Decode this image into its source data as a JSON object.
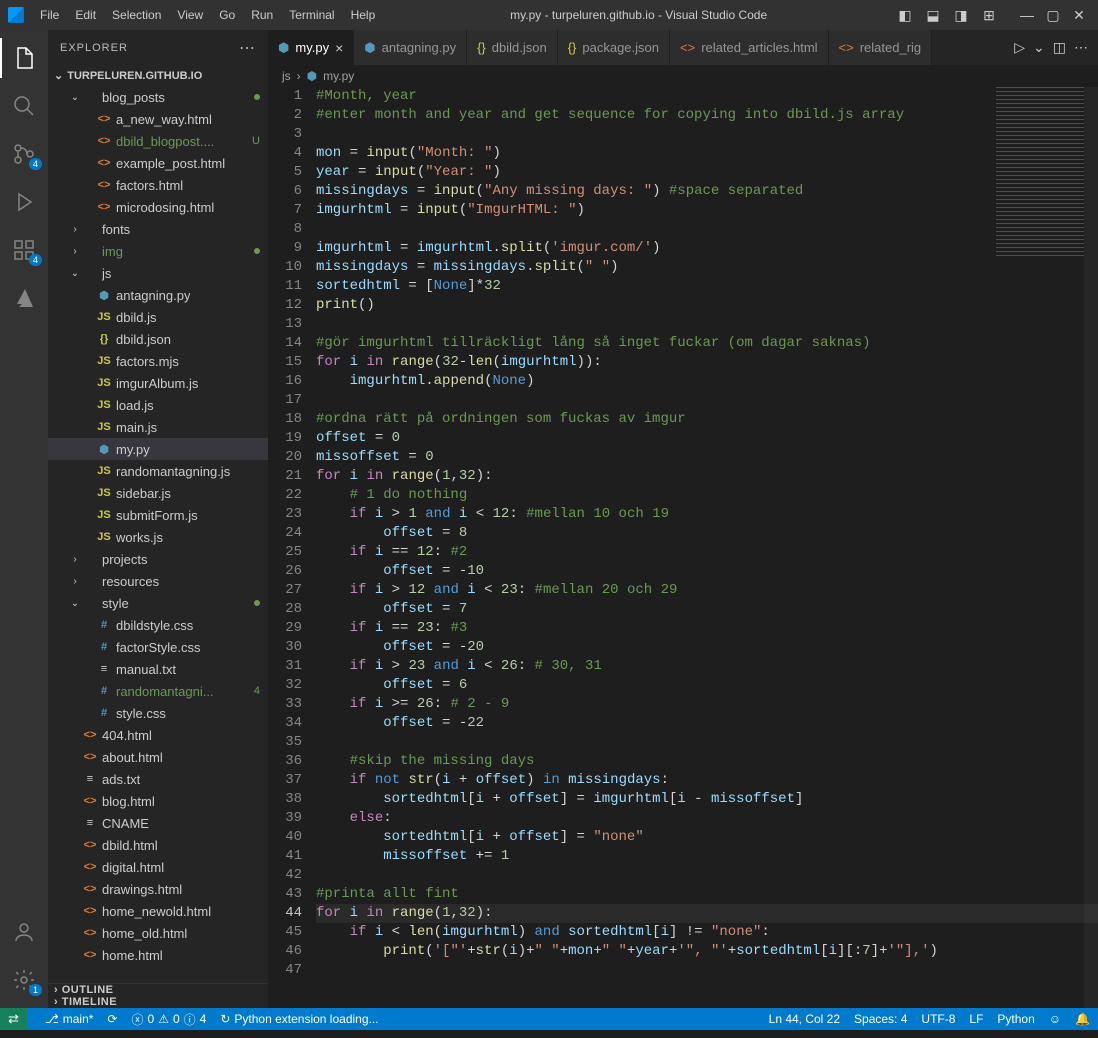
{
  "window": {
    "title": "my.py - turpeluren.github.io - Visual Studio Code"
  },
  "menu": [
    "File",
    "Edit",
    "Selection",
    "View",
    "Go",
    "Run",
    "Terminal",
    "Help"
  ],
  "activity": [
    {
      "name": "explorer-icon",
      "badge": ""
    },
    {
      "name": "search-icon",
      "badge": ""
    },
    {
      "name": "scm-icon",
      "badge": "4"
    },
    {
      "name": "debug-icon",
      "badge": ""
    },
    {
      "name": "extensions-icon",
      "badge": "4"
    },
    {
      "name": "azure-icon",
      "badge": ""
    }
  ],
  "sidebar": {
    "title": "EXPLORER",
    "root": "TURPELUREN.GITHUB.IO",
    "outline": "OUTLINE",
    "timeline": "TIMELINE"
  },
  "tree": [
    {
      "d": 1,
      "t": "folder",
      "open": true,
      "label": "blog_posts",
      "dot": true
    },
    {
      "d": 2,
      "t": "html",
      "label": "a_new_way.html"
    },
    {
      "d": 2,
      "t": "html",
      "label": "dbild_blogpost....",
      "status": "U",
      "mod": true
    },
    {
      "d": 2,
      "t": "html",
      "label": "example_post.html"
    },
    {
      "d": 2,
      "t": "html",
      "label": "factors.html"
    },
    {
      "d": 2,
      "t": "html",
      "label": "microdosing.html"
    },
    {
      "d": 1,
      "t": "folder",
      "open": false,
      "label": "fonts"
    },
    {
      "d": 1,
      "t": "folder",
      "open": false,
      "label": "img",
      "dot": true,
      "mod": true
    },
    {
      "d": 1,
      "t": "folder",
      "open": true,
      "label": "js"
    },
    {
      "d": 2,
      "t": "py",
      "label": "antagning.py"
    },
    {
      "d": 2,
      "t": "js",
      "label": "dbild.js"
    },
    {
      "d": 2,
      "t": "json",
      "label": "dbild.json"
    },
    {
      "d": 2,
      "t": "js",
      "label": "factors.mjs"
    },
    {
      "d": 2,
      "t": "js",
      "label": "imgurAlbum.js"
    },
    {
      "d": 2,
      "t": "js",
      "label": "load.js"
    },
    {
      "d": 2,
      "t": "js",
      "label": "main.js"
    },
    {
      "d": 2,
      "t": "py",
      "label": "my.py",
      "active": true
    },
    {
      "d": 2,
      "t": "js",
      "label": "randomantagning.js"
    },
    {
      "d": 2,
      "t": "js",
      "label": "sidebar.js"
    },
    {
      "d": 2,
      "t": "js",
      "label": "submitForm.js"
    },
    {
      "d": 2,
      "t": "js",
      "label": "works.js"
    },
    {
      "d": 1,
      "t": "folder",
      "open": false,
      "label": "projects"
    },
    {
      "d": 1,
      "t": "folder",
      "open": false,
      "label": "resources"
    },
    {
      "d": 1,
      "t": "folder",
      "open": true,
      "label": "style",
      "dot": true
    },
    {
      "d": 2,
      "t": "css",
      "label": "dbildstyle.css"
    },
    {
      "d": 2,
      "t": "css",
      "label": "factorStyle.css"
    },
    {
      "d": 2,
      "t": "txt",
      "label": "manual.txt"
    },
    {
      "d": 2,
      "t": "css",
      "label": "randomantagni...",
      "status": "4",
      "mod": true
    },
    {
      "d": 2,
      "t": "css",
      "label": "style.css"
    },
    {
      "d": 1,
      "t": "html",
      "label": "404.html"
    },
    {
      "d": 1,
      "t": "html",
      "label": "about.html"
    },
    {
      "d": 1,
      "t": "txt",
      "label": "ads.txt"
    },
    {
      "d": 1,
      "t": "html",
      "label": "blog.html"
    },
    {
      "d": 1,
      "t": "txt",
      "label": "CNAME"
    },
    {
      "d": 1,
      "t": "html",
      "label": "dbild.html"
    },
    {
      "d": 1,
      "t": "html",
      "label": "digital.html"
    },
    {
      "d": 1,
      "t": "html",
      "label": "drawings.html"
    },
    {
      "d": 1,
      "t": "html",
      "label": "home_newold.html"
    },
    {
      "d": 1,
      "t": "html",
      "label": "home_old.html"
    },
    {
      "d": 1,
      "t": "html",
      "label": "home.html"
    }
  ],
  "tabs": [
    {
      "icon": "py",
      "label": "my.py",
      "active": true,
      "close": true
    },
    {
      "icon": "py",
      "label": "antagning.py"
    },
    {
      "icon": "json",
      "label": "dbild.json"
    },
    {
      "icon": "json",
      "label": "package.json"
    },
    {
      "icon": "html",
      "label": "related_articles.html"
    },
    {
      "icon": "html",
      "label": "related_rig"
    }
  ],
  "breadcrumb": {
    "a": "js",
    "b": "my.py"
  },
  "code": {
    "lines": [
      {
        "n": 1,
        "h": "<span class='cm'>#Month, year</span>"
      },
      {
        "n": 2,
        "h": "<span class='cm'>#enter month and year and get sequence for copying into dbild.js array</span>"
      },
      {
        "n": 3,
        "h": ""
      },
      {
        "n": 4,
        "h": "<span class='va'>mon</span> <span class='op'>=</span> <span class='fn'>input</span>(<span class='st'>\"Month: \"</span>)"
      },
      {
        "n": 5,
        "h": "<span class='va'>year</span> <span class='op'>=</span> <span class='fn'>input</span>(<span class='st'>\"Year: \"</span>)"
      },
      {
        "n": 6,
        "h": "<span class='va'>missingdays</span> <span class='op'>=</span> <span class='fn'>input</span>(<span class='st'>\"Any missing days: \"</span>) <span class='cm'>#space separated</span>"
      },
      {
        "n": 7,
        "h": "<span class='va'>imgurhtml</span> <span class='op'>=</span> <span class='fn'>input</span>(<span class='st'>\"ImgurHTML: \"</span>)"
      },
      {
        "n": 8,
        "h": ""
      },
      {
        "n": 9,
        "h": "<span class='va'>imgurhtml</span> <span class='op'>=</span> <span class='va'>imgurhtml</span>.<span class='fn'>split</span>(<span class='st'>'imgur.com/'</span>)"
      },
      {
        "n": 10,
        "h": "<span class='va'>missingdays</span> <span class='op'>=</span> <span class='va'>missingdays</span>.<span class='fn'>split</span>(<span class='st'>\" \"</span>)"
      },
      {
        "n": 11,
        "h": "<span class='va'>sortedhtml</span> <span class='op'>=</span> [<span class='co'>None</span>]*<span class='nm'>32</span>"
      },
      {
        "n": 12,
        "h": "<span class='fn'>print</span>()"
      },
      {
        "n": 13,
        "h": ""
      },
      {
        "n": 14,
        "h": "<span class='cm'>#gör imgurhtml tillräckligt lång så inget fuckar (om dagar saknas)</span>"
      },
      {
        "n": 15,
        "h": "<span class='kw'>for</span> <span class='va'>i</span> <span class='kw'>in</span> <span class='fn'>range</span>(<span class='nm'>32</span>-<span class='fn'>len</span>(<span class='va'>imgurhtml</span>)):"
      },
      {
        "n": 16,
        "h": "    <span class='va'>imgurhtml</span>.<span class='fn'>append</span>(<span class='co'>None</span>)"
      },
      {
        "n": 17,
        "h": ""
      },
      {
        "n": 18,
        "h": "<span class='cm'>#ordna rätt på ordningen som fuckas av imgur</span>"
      },
      {
        "n": 19,
        "h": "<span class='va'>offset</span> <span class='op'>=</span> <span class='nm'>0</span>"
      },
      {
        "n": 20,
        "h": "<span class='va'>missoffset</span> <span class='op'>=</span> <span class='nm'>0</span>"
      },
      {
        "n": 21,
        "h": "<span class='kw'>for</span> <span class='va'>i</span> <span class='kw'>in</span> <span class='fn'>range</span>(<span class='nm'>1</span>,<span class='nm'>32</span>):"
      },
      {
        "n": 22,
        "h": "    <span class='cm'># 1 do nothing</span>"
      },
      {
        "n": 23,
        "h": "    <span class='kw'>if</span> <span class='va'>i</span> &gt; <span class='nm'>1</span> <span class='kw2'>and</span> <span class='va'>i</span> &lt; <span class='nm'>12</span>: <span class='cm'>#mellan 10 och 19</span>"
      },
      {
        "n": 24,
        "h": "        <span class='va'>offset</span> <span class='op'>=</span> <span class='nm'>8</span>"
      },
      {
        "n": 25,
        "h": "    <span class='kw'>if</span> <span class='va'>i</span> == <span class='nm'>12</span>: <span class='cm'>#2</span>"
      },
      {
        "n": 26,
        "h": "        <span class='va'>offset</span> <span class='op'>=</span> -<span class='nm'>10</span>"
      },
      {
        "n": 27,
        "h": "    <span class='kw'>if</span> <span class='va'>i</span> &gt; <span class='nm'>12</span> <span class='kw2'>and</span> <span class='va'>i</span> &lt; <span class='nm'>23</span>: <span class='cm'>#mellan 20 och 29</span>"
      },
      {
        "n": 28,
        "h": "        <span class='va'>offset</span> <span class='op'>=</span> <span class='nm'>7</span>"
      },
      {
        "n": 29,
        "h": "    <span class='kw'>if</span> <span class='va'>i</span> == <span class='nm'>23</span>: <span class='cm'>#3</span>"
      },
      {
        "n": 30,
        "h": "        <span class='va'>offset</span> <span class='op'>=</span> -<span class='nm'>20</span>"
      },
      {
        "n": 31,
        "h": "    <span class='kw'>if</span> <span class='va'>i</span> &gt; <span class='nm'>23</span> <span class='kw2'>and</span> <span class='va'>i</span> &lt; <span class='nm'>26</span>: <span class='cm'># 30, 31</span>"
      },
      {
        "n": 32,
        "h": "        <span class='va'>offset</span> <span class='op'>=</span> <span class='nm'>6</span>"
      },
      {
        "n": 33,
        "h": "    <span class='kw'>if</span> <span class='va'>i</span> &gt;= <span class='nm'>26</span>: <span class='cm'># 2 - 9</span>"
      },
      {
        "n": 34,
        "h": "        <span class='va'>offset</span> <span class='op'>=</span> -<span class='nm'>22</span>"
      },
      {
        "n": 35,
        "h": ""
      },
      {
        "n": 36,
        "h": "    <span class='cm'>#skip the missing days</span>"
      },
      {
        "n": 37,
        "h": "    <span class='kw'>if</span> <span class='kw2'>not</span> <span class='fn'>str</span>(<span class='va'>i</span> + <span class='va'>offset</span>) <span class='kw2'>in</span> <span class='va'>missingdays</span>:"
      },
      {
        "n": 38,
        "h": "        <span class='va'>sortedhtml</span>[<span class='va'>i</span> + <span class='va'>offset</span>] <span class='op'>=</span> <span class='va'>imgurhtml</span>[<span class='va'>i</span> - <span class='va'>missoffset</span>]"
      },
      {
        "n": 39,
        "h": "    <span class='kw'>else</span>:"
      },
      {
        "n": 40,
        "h": "        <span class='va'>sortedhtml</span>[<span class='va'>i</span> + <span class='va'>offset</span>] <span class='op'>=</span> <span class='st'>\"none\"</span>"
      },
      {
        "n": 41,
        "h": "        <span class='va'>missoffset</span> += <span class='nm'>1</span>"
      },
      {
        "n": 42,
        "h": ""
      },
      {
        "n": 43,
        "h": "<span class='cm'>#printa allt fint</span>"
      },
      {
        "n": 44,
        "h": "<span class='kw'>for</span> <span class='va'>i</span> <span class='kw'>in</span> <span class='fn'>range</span>(<span class='nm'>1</span>,<span class='nm'>32</span>):",
        "cur": true
      },
      {
        "n": 45,
        "h": "    <span class='kw'>if</span> <span class='va'>i</span> &lt; <span class='fn'>len</span>(<span class='va'>imgurhtml</span>) <span class='kw2'>and</span> <span class='va'>sortedhtml</span>[<span class='va'>i</span>] != <span class='st'>\"none\"</span>:"
      },
      {
        "n": 46,
        "h": "        <span class='fn'>print</span>(<span class='st'>'[\"'</span>+<span class='fn'>str</span>(<span class='va'>i</span>)+<span class='st'>\" \"</span>+<span class='va'>mon</span>+<span class='st'>\" \"</span>+<span class='va'>year</span>+<span class='st'>'\", \"'</span>+<span class='va'>sortedhtml</span>[<span class='va'>i</span>][:<span class='nm'>7</span>]+<span class='st'>'\"],'</span>)"
      },
      {
        "n": 47,
        "h": ""
      }
    ]
  },
  "status": {
    "branch": "main*",
    "sync": "",
    "errors": "0",
    "warnings": "0",
    "info": "4",
    "loading": "Python extension loading...",
    "cursor": "Ln 44, Col 22",
    "spaces": "Spaces: 4",
    "encoding": "UTF-8",
    "eol": "LF",
    "lang": "Python"
  }
}
